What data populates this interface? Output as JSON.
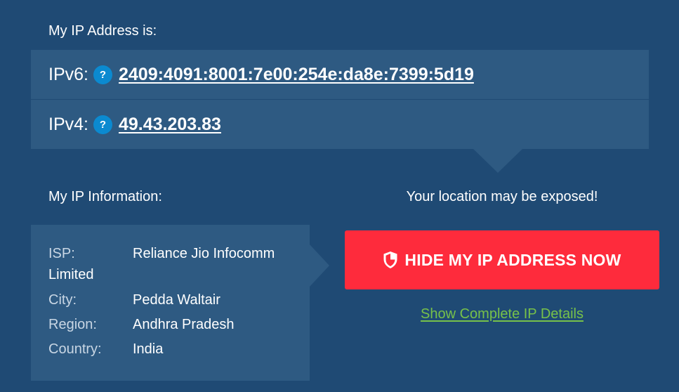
{
  "ip_address": {
    "title": "My IP Address is:",
    "ipv6": {
      "label": "IPv6:",
      "help": "?",
      "value": "2409:4091:8001:7e00:254e:da8e:7399:5d19"
    },
    "ipv4": {
      "label": "IPv4:",
      "help": "?",
      "value": "49.43.203.83"
    }
  },
  "ip_info": {
    "title": "My IP Information:",
    "isp": {
      "key": "ISP:",
      "value_line1": "Reliance Jio Infocomm",
      "value_line2": "Limited"
    },
    "city": {
      "key": "City:",
      "value": "Pedda Waltair"
    },
    "region": {
      "key": "Region:",
      "value": "Andhra Pradesh"
    },
    "country": {
      "key": "Country:",
      "value": "India"
    }
  },
  "warning": {
    "text": "Your location may be exposed!",
    "button_label": "HIDE MY IP ADDRESS NOW",
    "button_icon": "shield-icon",
    "details_link": "Show Complete IP Details"
  },
  "colors": {
    "background": "#1f4a74",
    "panel": "#2e5a82",
    "help_icon": "#0b8ad0",
    "button": "#fe2b3c",
    "link": "#77c14a"
  }
}
